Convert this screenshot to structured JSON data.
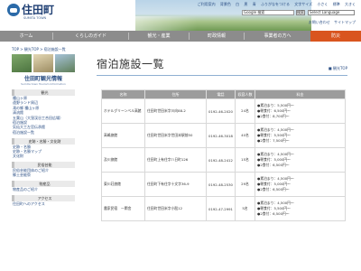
{
  "header": {
    "site_name": "住田町",
    "site_sub": "SUMITA TOWN",
    "top_links": [
      "ご利用案内",
      "背景色",
      "白",
      "黒",
      "青",
      "ふりがなをつける",
      "文字サイズ",
      "小さく",
      "標準",
      "大きく"
    ],
    "search_value": "Google 検索",
    "search_button": "検索",
    "language": "Select Language",
    "sub_links": [
      "お問い合わせ",
      "サイトマップ"
    ]
  },
  "nav": {
    "items": [
      "ホーム",
      "くらしのガイド",
      "観光・産業",
      "町政情報",
      "事業者の方へ",
      "防災"
    ],
    "active_index": 5
  },
  "breadcrumb": "TOP > 観光TOP > 宿泊施設一覧",
  "sidebar": {
    "title": "住田町観光情報",
    "title_en": "Sumita town Tourism Information",
    "sections": [
      {
        "heading": "観光",
        "links": [
          "種山ヶ原",
          "遠野ランド周辺",
          "滝の郷 種山ヶ原",
          "清流館",
          "五葉山（大窪渓谷工合田広場）",
          "宿泊施設",
          "気仙大工左官伝承館",
          "宿泊施設一覧"
        ]
      },
      {
        "heading": "史跡・名勝・文化財",
        "links": [
          "史跡・名勝",
          "史跡・名勝マップ",
          "文化財"
        ]
      },
      {
        "heading": "民俗芸能",
        "links": [
          "民俗芸能団体のご紹介",
          "郷土芸能祭"
        ]
      },
      {
        "heading": "物産品",
        "links": [
          "物産品のご紹介"
        ]
      },
      {
        "heading": "アクセス",
        "links": [
          "住田町へのアクセス"
        ]
      }
    ]
  },
  "main": {
    "title": "宿泊施設一覧",
    "back_to_top": "観光TOP",
    "table": {
      "headers": [
        "名称",
        "住所",
        "電話",
        "収容人数",
        "料金"
      ],
      "rows": [
        {
          "name": "ホテルグリーンベル高館",
          "address": "住田町世田米字川向88-2",
          "phone": "0192-46-2020",
          "capacity": "24名",
          "prices": [
            "●素泊まり：5,500円～",
            "●朝食付：6,500円～",
            "●2食付：8,700円～"
          ]
        },
        {
          "name": "高嶋旅館",
          "address": "住田町世田米字世田米駅前50",
          "phone": "0192-46-3018",
          "capacity": "40名",
          "prices": [
            "●素泊まり：4,500円～",
            "●朝食付：5,500円～",
            "●2食付：7,500円～"
          ]
        },
        {
          "name": "及川旅館",
          "address": "住田町上有住字八日町126",
          "phone": "0192-48-2412",
          "capacity": "15名",
          "prices": [
            "●素泊まり：4,500円～",
            "●朝食付：5,000円～",
            "●2食付：6,500円～"
          ]
        },
        {
          "name": "東川荘旅館",
          "address": "住田町下有住字十文字36-9",
          "phone": "0192-48-2530",
          "capacity": "29名",
          "prices": [
            "●素泊まり：4,500円～",
            "●朝食付：5,000円～",
            "●2食付：6,500円～"
          ]
        },
        {
          "name": "農家民宿　一閑舎",
          "address": "住田町世田米字小股12",
          "phone": "0192-47-2991",
          "capacity": "5名",
          "prices": [
            "●素泊まり：4,500円～",
            "●朝食付：5,500円～",
            "●2食付：6,500円～"
          ]
        }
      ]
    }
  },
  "colors": {
    "nav_bg": "#8c8c8c",
    "nav_active": "#d9551f",
    "link": "#2b4f85",
    "table_header": "#9c9c9c",
    "side_heading_bg": "#eaeaea"
  }
}
